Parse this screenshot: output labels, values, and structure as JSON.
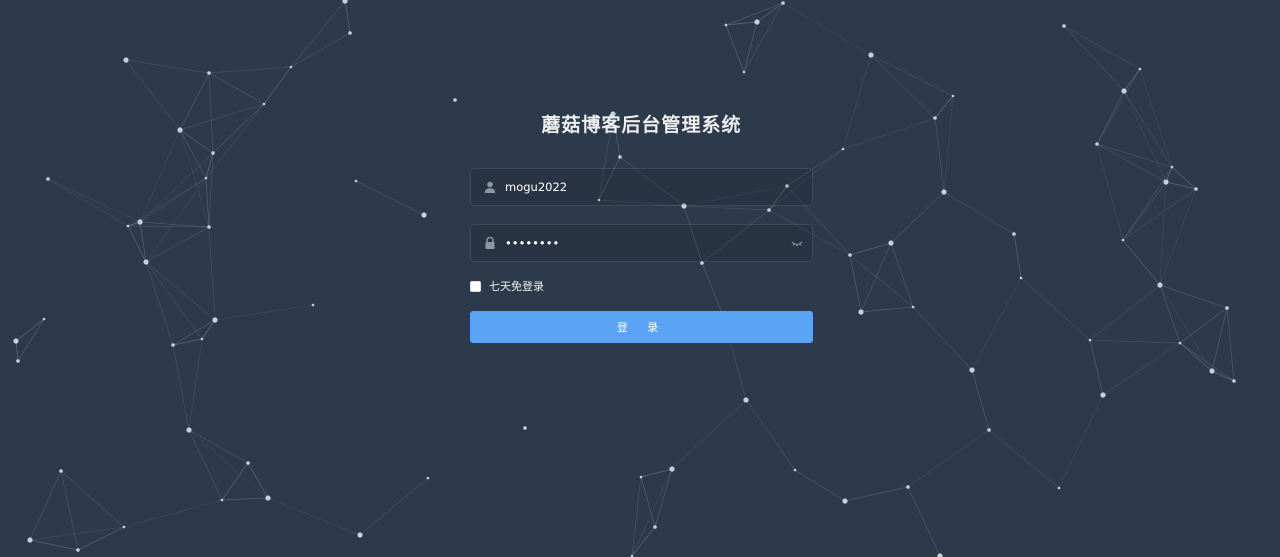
{
  "login": {
    "title": "蘑菇博客后台管理系统",
    "username_value": "mogu2022",
    "password_value": "mogu2022",
    "remember_label": "七天免登录",
    "remember_checked": false,
    "submit_label": "登 录"
  },
  "colors": {
    "background": "#2d3a4b",
    "button": "#5aa3f5",
    "text": "#eeeeee"
  },
  "icons": {
    "username": "user-icon",
    "password": "lock-icon",
    "toggle": "eye-closed-icon"
  }
}
